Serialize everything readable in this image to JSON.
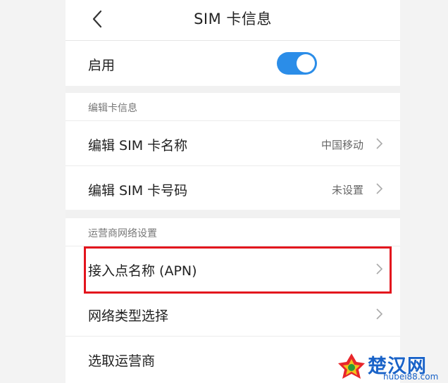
{
  "header": {
    "title": "SIM  卡信息"
  },
  "enable": {
    "label": "启用",
    "state": "on"
  },
  "sections": [
    {
      "title": "编辑卡信息",
      "items": [
        {
          "label": "编辑 SIM 卡名称",
          "value": "中国移动"
        },
        {
          "label": "编辑 SIM 卡号码",
          "value": "未设置"
        }
      ]
    },
    {
      "title": "运营商网络设置",
      "items": [
        {
          "label": "接入点名称 (APN)",
          "value": ""
        },
        {
          "label": "网络类型选择",
          "value": ""
        },
        {
          "label": "选取运营商",
          "value": ""
        }
      ]
    }
  ],
  "watermark": {
    "main": "楚汉网",
    "sub": "hubei88.com"
  },
  "colors": {
    "accent": "#2b8de8",
    "highlight": "#e3141d",
    "watermark": "#1a63c8"
  }
}
